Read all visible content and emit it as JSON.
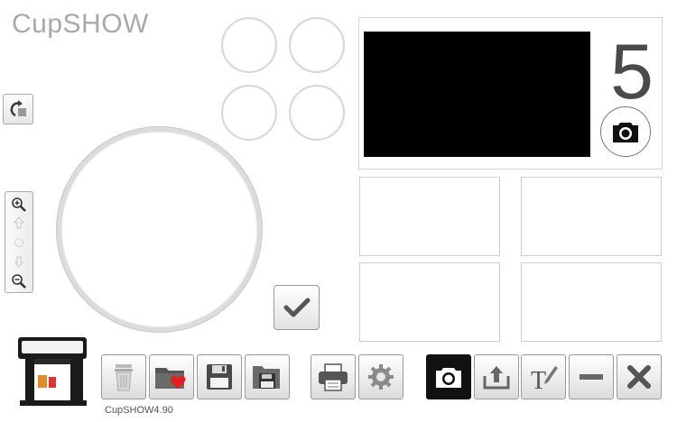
{
  "app": {
    "title": "CupSHOW",
    "version": "CupSHOW4.90"
  },
  "camera": {
    "countdown": "5"
  },
  "colors": {
    "accent_red": "#e02020",
    "preview_bg": "#000000",
    "active_tool": "#111111"
  },
  "toolbar": {
    "file_tools": [
      {
        "name": "delete",
        "icon": "trash-icon"
      },
      {
        "name": "favorites",
        "icon": "folder-heart-icon"
      },
      {
        "name": "save",
        "icon": "floppy-disk-icon"
      },
      {
        "name": "save-to-folder",
        "icon": "folder-floppy-icon"
      }
    ],
    "device_tools": [
      {
        "name": "print",
        "icon": "printer-icon"
      },
      {
        "name": "settings",
        "icon": "gear-icon"
      }
    ],
    "edit_tools": [
      {
        "name": "camera",
        "icon": "camera-icon",
        "active": true
      },
      {
        "name": "upload",
        "icon": "upload-icon"
      },
      {
        "name": "text",
        "icon": "text-tool-icon"
      },
      {
        "name": "remove",
        "icon": "minus-icon"
      },
      {
        "name": "close",
        "icon": "close-icon"
      }
    ]
  }
}
